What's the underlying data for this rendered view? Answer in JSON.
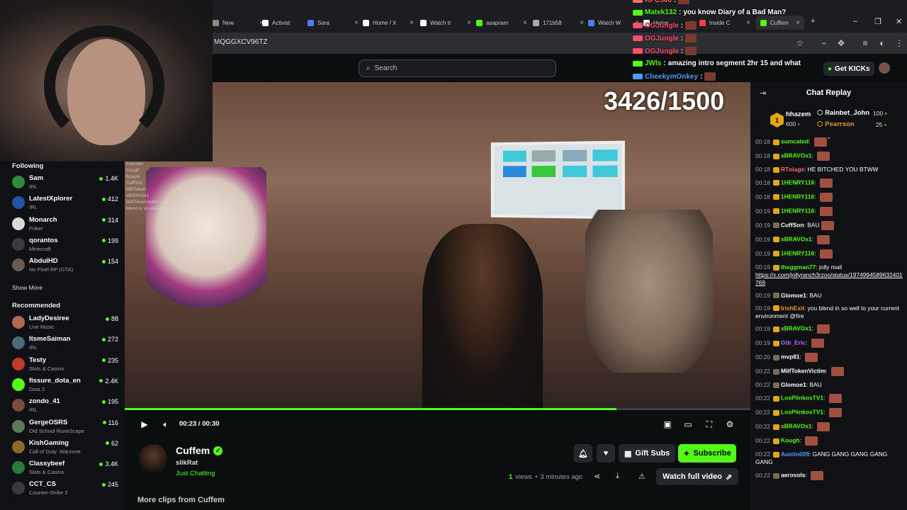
{
  "browser": {
    "tabs": [
      {
        "label": "New",
        "color": "#888"
      },
      {
        "label": "Activist",
        "color": "#ffffff"
      },
      {
        "label": "Sora",
        "color": "#4f7cff"
      },
      {
        "label": "Home / X",
        "color": "#ffffff"
      },
      {
        "label": "Watch tr",
        "color": "#ffffff"
      },
      {
        "label": "asapram",
        "color": "#53fc18"
      },
      {
        "label": "171b58",
        "color": "#aaaaaa"
      },
      {
        "label": "Watch W",
        "color": "#4f7cff"
      },
      {
        "label": "Home",
        "color": "#ffffff"
      },
      {
        "label": "Inside C",
        "color": "#ff3b3b"
      },
      {
        "label": "Cuffem",
        "color": "#53fc18"
      }
    ],
    "url": "MQGGXCV96TZ"
  },
  "header": {
    "search_placeholder": "Search",
    "get_kicks": "Get KICKs"
  },
  "sidebar": {
    "following_title": "Following",
    "following": [
      {
        "name": "Sam",
        "category": "IRL",
        "viewers": "1.4K",
        "color": "#2e8b3e"
      },
      {
        "name": "LatestXplorer",
        "category": "IRL",
        "viewers": "412",
        "color": "#2451a6"
      },
      {
        "name": "Monarch",
        "category": "Poker",
        "viewers": "314",
        "color": "#d8d8d8"
      },
      {
        "name": "qorantos",
        "category": "Minecraft",
        "viewers": "199",
        "color": "#3a3a3a"
      },
      {
        "name": "AbdulHD",
        "category": "No Pixel RP (GTA)",
        "viewers": "154",
        "color": "#6a5a50"
      }
    ],
    "show_more": "Show More",
    "recommended_title": "Recommended",
    "recommended": [
      {
        "name": "LadyDesiree",
        "category": "Live Music",
        "viewers": "88",
        "color": "#b06a50"
      },
      {
        "name": "ItsmeSaiman",
        "category": "IRL",
        "viewers": "272",
        "color": "#4a6a7a"
      },
      {
        "name": "Testy",
        "category": "Slots & Casino",
        "viewers": "235",
        "color": "#c23a2a"
      },
      {
        "name": "fissure_dota_en",
        "category": "Dota 2",
        "viewers": "2.4K",
        "color": "#53fc18"
      },
      {
        "name": "zondo_41",
        "category": "IRL",
        "viewers": "195",
        "color": "#7a4a3a"
      },
      {
        "name": "GergeOSRS",
        "category": "Old School RuneScape",
        "viewers": "116",
        "color": "#5a7a5a"
      },
      {
        "name": "KishGaming",
        "category": "Call of Duty: Warzone",
        "viewers": "62",
        "color": "#8a6a2a"
      },
      {
        "name": "Classybeef",
        "category": "Slots & Casino",
        "viewers": "3.4K",
        "color": "#2a7a3a"
      },
      {
        "name": "CCT_CS",
        "category": "Counter-Strike 2",
        "viewers": "245",
        "color": "#3a3a3a"
      }
    ]
  },
  "video": {
    "goal_text": "3426/1500",
    "time": "00:23 / 00:30",
    "progress": 0.786
  },
  "overlay_chat": [
    {
      "user": "KPC500",
      "text": "",
      "color": "#ff6b6b"
    },
    {
      "user": "Matek132",
      "text": "you know Diary of a Bad Man?",
      "color": "#53fc18"
    },
    {
      "user": "OGJungle",
      "text": "",
      "color": "#ff4d6d"
    },
    {
      "user": "OGJungle",
      "text": "",
      "color": "#ff4d6d"
    },
    {
      "user": "OGJungle",
      "text": "",
      "color": "#ff4d6d"
    },
    {
      "user": "JWls",
      "text": "amazing intro segment 2hr 15 and what",
      "color": "#53fc18"
    },
    {
      "user": "CheekymOnkey",
      "text": "",
      "color": "#4f9cff"
    }
  ],
  "overlay_mini_chat": [
    "Kouman",
    "Kough",
    "fissure",
    "CuffSon",
    "MilfToken",
    "xBRAVOx1",
    "MilfTokenVictim",
    "blend in so well to your current environment"
  ],
  "channel": {
    "name": "Cuffem",
    "clipped_by": "slikRat",
    "category": "Just Chatting",
    "gift_subs": "Gift Subs",
    "subscribe": "Subscribe",
    "views_count": "1",
    "views_label": "views",
    "time_ago": "3 minutes ago",
    "watch_full": "Watch full video",
    "more_clips": "More clips from Cuffem"
  },
  "chat": {
    "title": "Chat Replay",
    "gifters": [
      {
        "name": "hhazem",
        "amount": "600",
        "color": "#ffffff"
      },
      {
        "name": "Rainbet_John",
        "amount": "100",
        "color": "#ffffff"
      },
      {
        "name": "Pearrson",
        "amount": "25",
        "color": "#e39a2a"
      }
    ],
    "gifter_rank": "1",
    "messages": [
      {
        "ts": "00:18",
        "user": "sumcated",
        "text": "",
        "color": "#53fc18",
        "emote": true
      },
      {
        "ts": "00:18",
        "user": "xBRAVOx1",
        "text": "",
        "color": "#53fc18",
        "emote": true
      },
      {
        "ts": "00:18",
        "user": "RTniage",
        "text": "HE BITCHED YOU BTWW",
        "color": "#ff6b6b",
        "emote": false
      },
      {
        "ts": "00:18",
        "user": "1HENRY116",
        "text": "",
        "color": "#53fc18",
        "emote": true
      },
      {
        "ts": "00:18",
        "user": "1HENRY116",
        "text": "",
        "color": "#53fc18",
        "emote": true
      },
      {
        "ts": "00:19",
        "user": "1HENRY116",
        "text": "",
        "color": "#53fc18",
        "emote": true
      },
      {
        "ts": "00:19",
        "user": "CuffSon",
        "text": "BAU",
        "color": "#ffffff",
        "emote": true
      },
      {
        "ts": "00:19",
        "user": "xBRAVOx1",
        "text": "",
        "color": "#53fc18",
        "emote": true
      },
      {
        "ts": "00:19",
        "user": "1HENRY116",
        "text": "",
        "color": "#53fc18",
        "emote": true
      },
      {
        "ts": "00:19",
        "user": "theggman77",
        "text": "jolly mail",
        "color": "#53fc18",
        "emote": false,
        "link": "https://x.com/jollyranch3rzoo/status/1974994589632401769"
      },
      {
        "ts": "00:19",
        "user": "Glomoe1",
        "text": "BAU",
        "color": "#ffffff",
        "emote": false
      },
      {
        "ts": "00:19",
        "user": "IrishExit",
        "text": "you blend in so well to your current environment @fire",
        "color": "#e39a2a",
        "emote": false
      },
      {
        "ts": "00:19",
        "user": "xBRAVOx1",
        "text": "",
        "color": "#53fc18",
        "emote": true
      },
      {
        "ts": "00:19",
        "user": "Gtb_Eric",
        "text": "",
        "color": "#b06aff",
        "emote": true
      },
      {
        "ts": "00:20",
        "user": "mvp81",
        "text": "",
        "color": "#ffffff",
        "emote": true
      },
      {
        "ts": "00:22",
        "user": "MilfTokenVictim",
        "text": "",
        "color": "#ffffff",
        "emote": true
      },
      {
        "ts": "00:22",
        "user": "Glomoe1",
        "text": "BAU",
        "color": "#ffffff",
        "emote": false
      },
      {
        "ts": "00:22",
        "user": "LosPlinkosTV1",
        "text": "",
        "color": "#53fc18",
        "emote": true
      },
      {
        "ts": "00:22",
        "user": "LosPlinkosTV1",
        "text": "",
        "color": "#53fc18",
        "emote": true
      },
      {
        "ts": "00:22",
        "user": "xBRAVOx1",
        "text": "",
        "color": "#53fc18",
        "emote": true
      },
      {
        "ts": "00:22",
        "user": "Kough",
        "text": "",
        "color": "#53fc18",
        "emote": true
      },
      {
        "ts": "00:22",
        "user": "Austin009",
        "text": "GANG GANG GANG GANG GANG",
        "color": "#4f9cff",
        "emote": false
      },
      {
        "ts": "00:22",
        "user": "aerosols",
        "text": "",
        "color": "#ffffff",
        "emote": true
      }
    ]
  }
}
